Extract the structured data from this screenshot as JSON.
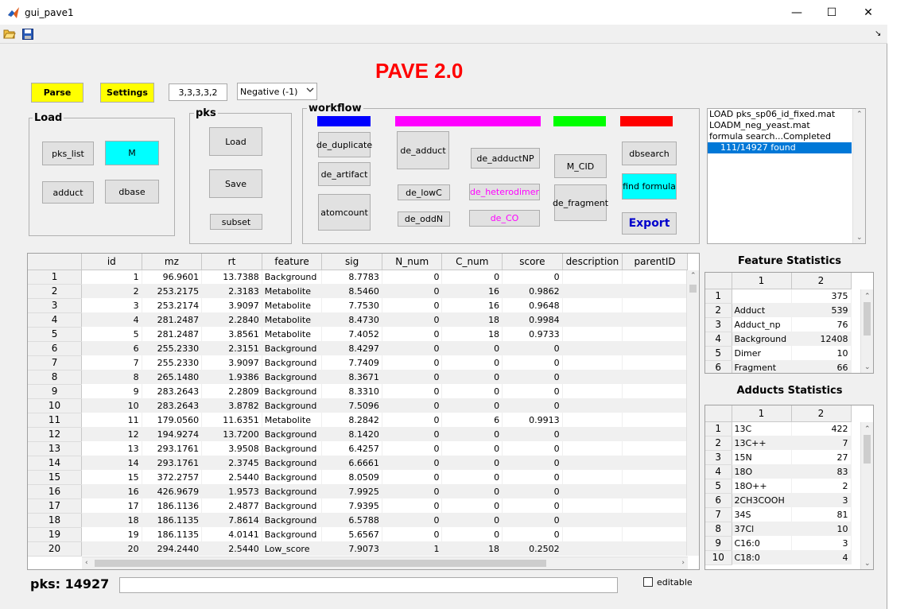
{
  "window": {
    "title": "gui_pave1",
    "minimize": "—",
    "maximize": "☐",
    "close": "✕"
  },
  "toolbar": {
    "open_icon": "folder-open-icon",
    "save_icon": "floppy-icon",
    "dock_icon": "dock-arrow-icon"
  },
  "header": {
    "title": "PAVE  2.0"
  },
  "controls": {
    "parse": "Parse",
    "settings": "Settings",
    "param_value": "3,3,3,3,2",
    "mode_selected": "Negative (-1)"
  },
  "load_panel": {
    "label": "Load",
    "pks_list": "pks_list",
    "m": "M",
    "adduct": "adduct",
    "dbase": "dbase"
  },
  "pks_panel": {
    "label": "pks",
    "load": "Load",
    "save": "Save",
    "subset": "subset"
  },
  "workflow": {
    "label": "workflow",
    "colors": {
      "blue": "#0000ff",
      "magenta": "#ff00ff",
      "green": "#00ff00",
      "red": "#ff0000"
    },
    "de_duplicate": "de_duplicate",
    "de_artifact": "de_artifact",
    "atomcount": "atomcount",
    "de_adduct": "de_adduct",
    "de_adductNP": "de_adductNP",
    "de_lowC": "de_lowC",
    "de_heterodimer": "de_heterodimer",
    "de_oddN": "de_oddN",
    "de_CO": "de_CO",
    "m_cid": "M_CID",
    "de_fragment": "de_fragment",
    "dbsearch": "dbsearch",
    "find_formula": "find formula",
    "export": "Export"
  },
  "log": {
    "items": [
      "LOAD pks_sp06_id_fixed.mat",
      "LOADM_neg_yeast.mat",
      "formula search...Completed"
    ],
    "selected": "111/14927 found"
  },
  "main_table": {
    "columns": [
      "id",
      "mz",
      "rt",
      "feature",
      "sig",
      "N_num",
      "C_num",
      "score",
      "description",
      "parentID"
    ],
    "rows": [
      [
        "1",
        "1",
        "96.9601",
        "13.7388",
        "Background",
        "8.7783",
        "0",
        "0",
        "0",
        "",
        ""
      ],
      [
        "2",
        "2",
        "253.2175",
        "2.3183",
        "Metabolite",
        "8.5460",
        "0",
        "16",
        "0.9862",
        "",
        ""
      ],
      [
        "3",
        "3",
        "253.2174",
        "3.9097",
        "Metabolite",
        "7.7530",
        "0",
        "16",
        "0.9648",
        "",
        ""
      ],
      [
        "4",
        "4",
        "281.2487",
        "2.2840",
        "Metabolite",
        "8.4730",
        "0",
        "18",
        "0.9984",
        "",
        ""
      ],
      [
        "5",
        "5",
        "281.2487",
        "3.8561",
        "Metabolite",
        "7.4052",
        "0",
        "18",
        "0.9733",
        "",
        ""
      ],
      [
        "6",
        "6",
        "255.2330",
        "2.3151",
        "Background",
        "8.4297",
        "0",
        "0",
        "0",
        "",
        ""
      ],
      [
        "7",
        "7",
        "255.2330",
        "3.9097",
        "Background",
        "7.7409",
        "0",
        "0",
        "0",
        "",
        ""
      ],
      [
        "8",
        "8",
        "265.1480",
        "1.9386",
        "Background",
        "8.3671",
        "0",
        "0",
        "0",
        "",
        ""
      ],
      [
        "9",
        "9",
        "283.2643",
        "2.2809",
        "Background",
        "8.3310",
        "0",
        "0",
        "0",
        "",
        ""
      ],
      [
        "10",
        "10",
        "283.2643",
        "3.8782",
        "Background",
        "7.5096",
        "0",
        "0",
        "0",
        "",
        ""
      ],
      [
        "11",
        "11",
        "179.0560",
        "11.6351",
        "Metabolite",
        "8.2842",
        "0",
        "6",
        "0.9913",
        "",
        ""
      ],
      [
        "12",
        "12",
        "194.9274",
        "13.7200",
        "Background",
        "8.1420",
        "0",
        "0",
        "0",
        "",
        ""
      ],
      [
        "13",
        "13",
        "293.1761",
        "3.9508",
        "Background",
        "6.4257",
        "0",
        "0",
        "0",
        "",
        ""
      ],
      [
        "14",
        "14",
        "293.1761",
        "2.3745",
        "Background",
        "6.6661",
        "0",
        "0",
        "0",
        "",
        ""
      ],
      [
        "15",
        "15",
        "372.2757",
        "2.5440",
        "Background",
        "8.0509",
        "0",
        "0",
        "0",
        "",
        ""
      ],
      [
        "16",
        "16",
        "426.9679",
        "1.9573",
        "Background",
        "7.9925",
        "0",
        "0",
        "0",
        "",
        ""
      ],
      [
        "17",
        "17",
        "186.1136",
        "2.4877",
        "Background",
        "7.9395",
        "0",
        "0",
        "0",
        "",
        ""
      ],
      [
        "18",
        "18",
        "186.1135",
        "7.8614",
        "Background",
        "6.5788",
        "0",
        "0",
        "0",
        "",
        ""
      ],
      [
        "19",
        "19",
        "186.1135",
        "4.0141",
        "Background",
        "5.6567",
        "0",
        "0",
        "0",
        "",
        ""
      ],
      [
        "20",
        "20",
        "294.2440",
        "2.5440",
        "Low_score",
        "7.9073",
        "1",
        "18",
        "0.2502",
        "",
        ""
      ]
    ]
  },
  "feature_stats": {
    "title": "Feature Statistics",
    "columns": [
      "1",
      "2"
    ],
    "rows": [
      [
        "1",
        "",
        "375"
      ],
      [
        "2",
        "Adduct",
        "539"
      ],
      [
        "3",
        "Adduct_np",
        "76"
      ],
      [
        "4",
        "Background",
        "12408"
      ],
      [
        "5",
        "Dimer",
        "10"
      ],
      [
        "6",
        "Fragment",
        "66"
      ]
    ]
  },
  "adducts_stats": {
    "title": "Adducts Statistics",
    "columns": [
      "1",
      "2"
    ],
    "rows": [
      [
        "1",
        "13C",
        "422"
      ],
      [
        "2",
        "13C++",
        "7"
      ],
      [
        "3",
        "15N",
        "27"
      ],
      [
        "4",
        "18O",
        "83"
      ],
      [
        "5",
        "18O++",
        "2"
      ],
      [
        "6",
        "2CH3COOH",
        "3"
      ],
      [
        "7",
        "34S",
        "81"
      ],
      [
        "8",
        "37Cl",
        "10"
      ],
      [
        "9",
        "C16:0",
        "3"
      ],
      [
        "10",
        "C18:0",
        "4"
      ]
    ]
  },
  "footer": {
    "pks_count": "pks: 14927",
    "editable_label": "editable",
    "editable_checked": false
  }
}
